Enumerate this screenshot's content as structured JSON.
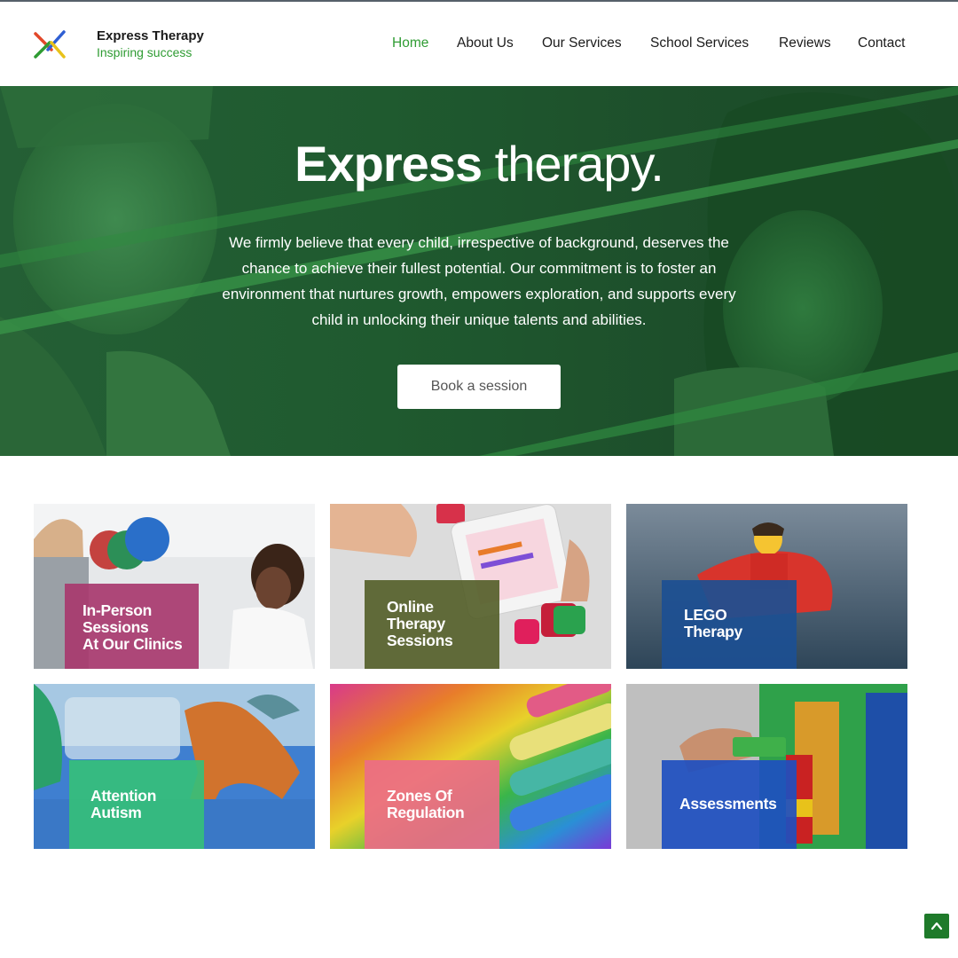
{
  "brand": {
    "name": "Express Therapy",
    "tagline": "Inspiring success",
    "logo_icon": "cross-arrows-logo"
  },
  "nav": {
    "items": [
      {
        "label": "Home",
        "active": true
      },
      {
        "label": "About Us",
        "active": false
      },
      {
        "label": "Our Services",
        "active": false
      },
      {
        "label": "School Services",
        "active": false
      },
      {
        "label": "Reviews",
        "active": false
      },
      {
        "label": "Contact",
        "active": false
      }
    ]
  },
  "hero": {
    "title_bold": "Express",
    "title_light": " therapy.",
    "text": "We firmly believe that every child, irrespective of background, deserves the chance to achieve their fullest potential. Our commitment is to foster an environment that nurtures growth, empowers exploration, and supports every child in unlocking their unique talents and abilities.",
    "button_label": "Book a session"
  },
  "services": [
    {
      "label_lines": [
        "In-Person",
        "Sessions",
        "At Our Clinics"
      ],
      "box_color": "#a8386e"
    },
    {
      "label_lines": [
        "Online",
        "Therapy",
        "Sessions"
      ],
      "box_color": "#55602a"
    },
    {
      "label_lines": [
        "LEGO",
        "Therapy"
      ],
      "box_color": "#1c4f93"
    },
    {
      "label_lines": [
        "Attention",
        "Autism"
      ],
      "box_color": "#35bf7a"
    },
    {
      "label_lines": [
        "Zones Of",
        "Regulation"
      ],
      "box_color": "#ec6c86"
    },
    {
      "label_lines": [
        "Assessments"
      ],
      "box_color": "#1e4fc0"
    }
  ],
  "colors": {
    "accent_green": "#2f9c33",
    "hero_green": "#1f5a2f",
    "scroll_button": "#1e7a2a"
  },
  "scroll_top_icon": "chevron-up-icon"
}
